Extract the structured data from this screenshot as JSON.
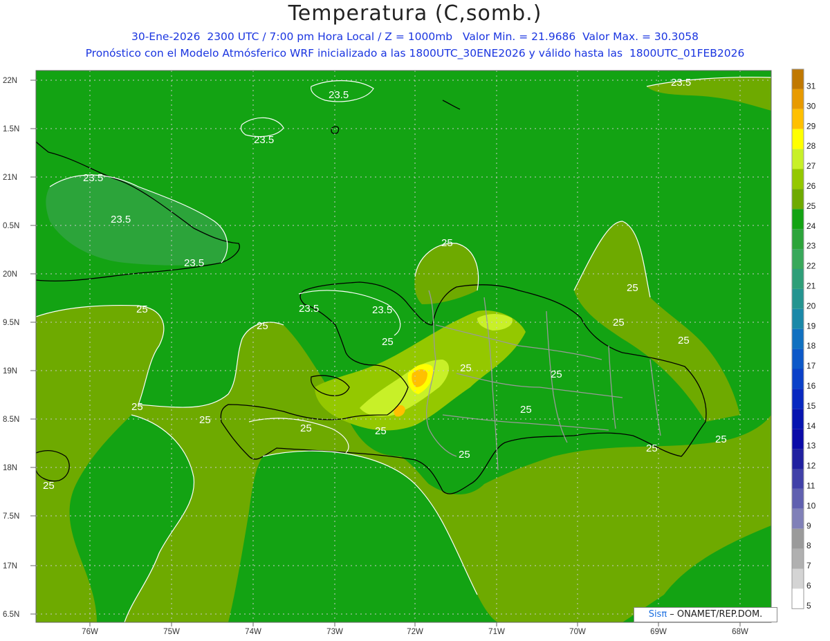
{
  "header": {
    "title": "Temperatura (C,somb.)",
    "line1": "30-Ene-2026  2300 UTC / 7:00 pm Hora Local / Z = 1000mb   Valor Min. = 21.9686  Valor Max. = 30.3058",
    "line2": "Pronóstico con el Modelo Atmósferico WRF inicializado a las 1800UTC_30ENE2026 y válido hasta las  1800UTC_01FEB2026"
  },
  "axes": {
    "lat_labels": [
      "22N",
      "1.5N",
      "21N",
      "0.5N",
      "20N",
      "9.5N",
      "19N",
      "8.5N",
      "18N",
      "7.5N",
      "17N",
      "6.5N"
    ],
    "lon_labels": [
      "76W",
      "75W",
      "74W",
      "73W",
      "72W",
      "71W",
      "70W",
      "69W",
      "68W"
    ]
  },
  "contour_labels": [
    "23.5",
    "23.5",
    "23.5",
    "23.5",
    "23.5",
    "23.5",
    "23.5",
    "23.5",
    "25",
    "25",
    "25",
    "25",
    "25",
    "25",
    "25",
    "25",
    "25",
    "25",
    "25",
    "25",
    "25",
    "25",
    "25",
    "25",
    "25",
    "25"
  ],
  "colorbar": {
    "labels": [
      "31",
      "30",
      "29",
      "28",
      "27",
      "26",
      "25",
      "24",
      "23",
      "22",
      "21",
      "20",
      "19",
      "18",
      "17",
      "16",
      "15",
      "14",
      "13",
      "12",
      "11",
      "10",
      "9",
      "8",
      "7",
      "6",
      "5"
    ],
    "colors": [
      "#c07800",
      "#e89a00",
      "#ffc000",
      "#ffff00",
      "#c8f028",
      "#94c800",
      "#6eaa00",
      "#13a313",
      "#2ca43a",
      "#38a85a",
      "#2e9e78",
      "#249490",
      "#1a88a8",
      "#1070c0",
      "#0c58c8",
      "#0a40c8",
      "#0828c0",
      "#0614b0",
      "#0a0aa8",
      "#2020a0",
      "#4040a8",
      "#6060b0",
      "#8080b8",
      "#9a9a9a",
      "#b0b0b0",
      "#d4d4d4",
      "#ffffff"
    ]
  },
  "credit": {
    "logo": "Sisπ",
    "text": " – ONAMET/REP.DOM."
  }
}
